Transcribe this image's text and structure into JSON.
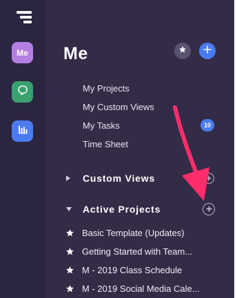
{
  "icons": {
    "logo": "stacked-bars-logo-icon",
    "chat": "chat-bubble-icon",
    "stats": "bar-chart-icon",
    "star": "star-icon",
    "plus": "plus-icon",
    "triangle_right": "triangle-right-icon",
    "triangle_down": "triangle-down-icon",
    "circle_plus": "circle-plus-icon",
    "annotation_arrow": "pink-arrow-annotation"
  },
  "colors": {
    "background": "#342b47",
    "rail": "#2b2540",
    "me_avatar": "#b57ee3",
    "chat": "#3aa06f",
    "accent_blue": "#4a7cf0",
    "arrow": "#ff2d6a"
  },
  "rail": {
    "me_label": "Me"
  },
  "header": {
    "title": "Me"
  },
  "menu": [
    {
      "label": "My Projects"
    },
    {
      "label": "My Custom Views"
    },
    {
      "label": "My Tasks",
      "badge": "10"
    },
    {
      "label": "Time Sheet"
    }
  ],
  "sections": {
    "custom_views": "Custom Views",
    "active_projects": "Active Projects"
  },
  "projects": [
    {
      "name": "Basic Template (Updates)"
    },
    {
      "name": "Getting Started with Team..."
    },
    {
      "name": "M - 2019 Class Schedule"
    },
    {
      "name": "M - 2019 Social Media Cale..."
    }
  ]
}
